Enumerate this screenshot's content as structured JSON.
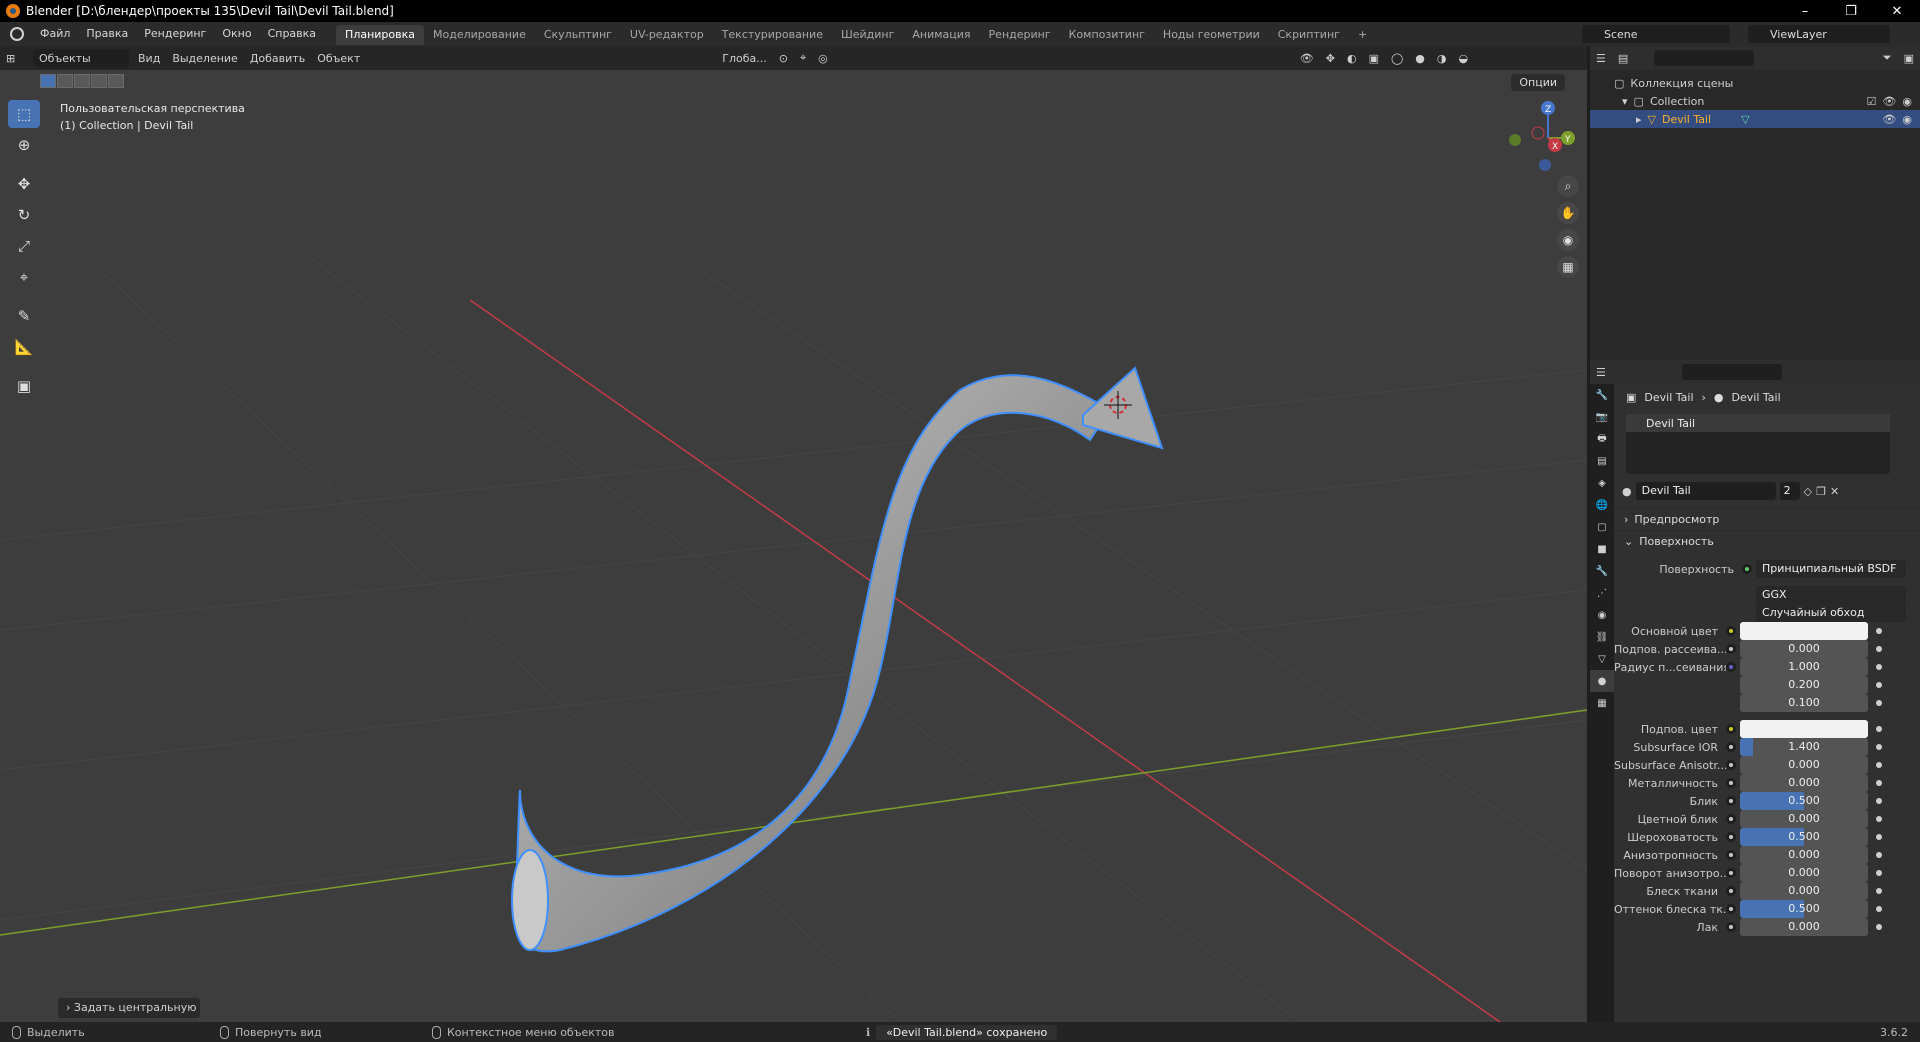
{
  "window": {
    "title": "Blender [D:\\блендер\\проекты 135\\Devil Tail\\Devil Tail.blend]",
    "controls": [
      "–",
      "❐",
      "✕"
    ]
  },
  "menu": [
    "Файл",
    "Правка",
    "Рендеринг",
    "Окно",
    "Справка"
  ],
  "workspaces": [
    "Планировка",
    "Моделирование",
    "Скульптинг",
    "UV-редактор",
    "Текстурирование",
    "Шейдинг",
    "Анимация",
    "Рендеринг",
    "Композитинг",
    "Ноды геометрии",
    "Скриптинг",
    "+"
  ],
  "active_workspace": "Планировка",
  "scene": "Scene",
  "view_layer": "ViewLayer",
  "viewport_header": {
    "mode": "Объекты",
    "menus": [
      "Вид",
      "Выделение",
      "Добавить",
      "Объект"
    ],
    "orientation": "Глоба..."
  },
  "viewport": {
    "perspective_label": "Пользовательская перспектива",
    "collection_label": "(1) Collection | Devil Tail",
    "options": "Опции",
    "last_operation": "Задать центральную точ",
    "gizmo_labels": {
      "x": "X",
      "y": "Y",
      "z": "Z"
    }
  },
  "status_bar": {
    "select": "Выделить",
    "rotate": "Повернуть вид",
    "context": "Контекстное меню объектов",
    "notice": "«Devil Tail.blend» сохранено",
    "version": "3.6.2"
  },
  "outliner": {
    "root": "Коллекция сцены",
    "collection": "Collection",
    "object": "Devil Tail"
  },
  "properties": {
    "breadcrumb_object": "Devil Tail",
    "breadcrumb_material": "Devil Tail",
    "slot": "Devil Tail",
    "material_name": "Devil Tail",
    "user_count": "2",
    "panels": {
      "preview": "Предпросмотр",
      "surface": "Поверхность"
    },
    "surface_label": "Поверхность",
    "surface_value": "Принципиальный BSDF",
    "distribution": "GGX",
    "subsurface_method": "Случайный обход",
    "fields": [
      {
        "label": "Основной цвет",
        "value": "",
        "kind": "color",
        "socket": "yellow"
      },
      {
        "label": "Подпов. рассеива...",
        "value": "0.000",
        "kind": "num",
        "socket": "grey",
        "fill": 0
      },
      {
        "label": "Радиус п...сеивания",
        "value": "1.000",
        "kind": "num",
        "socket": "blue",
        "fill": 0
      },
      {
        "label": "",
        "value": "0.200",
        "kind": "num",
        "socket": "",
        "fill": 0
      },
      {
        "label": "",
        "value": "0.100",
        "kind": "num",
        "socket": "",
        "fill": 0
      },
      {
        "label": "Подпов. цвет",
        "value": "",
        "kind": "color",
        "socket": "yellow"
      },
      {
        "label": "Subsurface IOR",
        "value": "1.400",
        "kind": "num",
        "socket": "grey",
        "fill": 0.1
      },
      {
        "label": "Subsurface Anisotr...",
        "value": "0.000",
        "kind": "num",
        "socket": "grey",
        "fill": 0
      },
      {
        "label": "Металличность",
        "value": "0.000",
        "kind": "num",
        "socket": "grey",
        "fill": 0
      },
      {
        "label": "Блик",
        "value": "0.500",
        "kind": "num",
        "socket": "grey",
        "fill": 0.5
      },
      {
        "label": "Цветной блик",
        "value": "0.000",
        "kind": "num",
        "socket": "grey",
        "fill": 0
      },
      {
        "label": "Шероховатость",
        "value": "0.500",
        "kind": "num",
        "socket": "grey",
        "fill": 0.5
      },
      {
        "label": "Анизотропность",
        "value": "0.000",
        "kind": "num",
        "socket": "grey",
        "fill": 0
      },
      {
        "label": "Поворот анизотро...",
        "value": "0.000",
        "kind": "num",
        "socket": "grey",
        "fill": 0
      },
      {
        "label": "Блеск ткани",
        "value": "0.000",
        "kind": "num",
        "socket": "grey",
        "fill": 0
      },
      {
        "label": "Оттенок блеска тк...",
        "value": "0.500",
        "kind": "num",
        "socket": "grey",
        "fill": 0.5
      },
      {
        "label": "Лак",
        "value": "0.000",
        "kind": "num",
        "socket": "grey",
        "fill": 0
      }
    ]
  },
  "colors": {
    "accent": "#4772b3",
    "selection_outline": "#3f8fff",
    "x_axis": "#c43b45",
    "y_axis": "#7e9f2a",
    "active_object": "#ffaf29"
  }
}
